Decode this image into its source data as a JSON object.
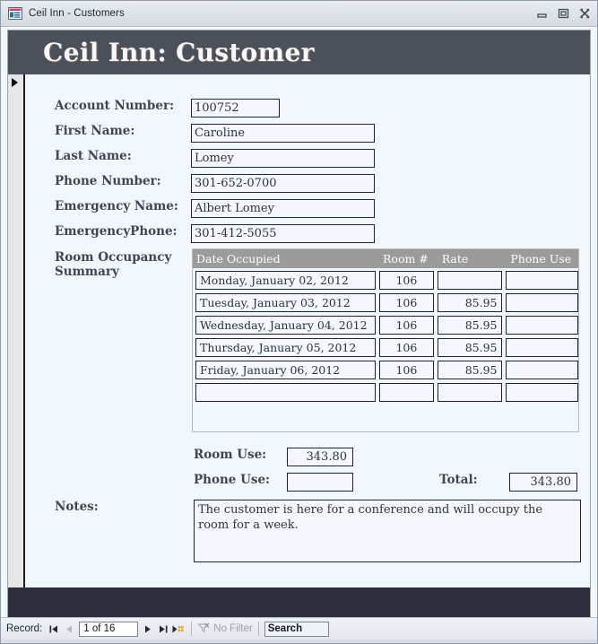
{
  "window": {
    "title": "Ceil Inn - Customers",
    "icon": "access-form-icon",
    "controls": {
      "minimize": "minimize-icon",
      "restore": "restore-icon",
      "close": "close-icon"
    }
  },
  "form": {
    "header_title": "Ceil Inn: Customer",
    "fields": [
      {
        "label": "Account Number:",
        "value": "100752"
      },
      {
        "label": "First Name:",
        "value": "Caroline"
      },
      {
        "label": "Last Name:",
        "value": "Lomey"
      },
      {
        "label": "Phone Number:",
        "value": "301-652-0700"
      },
      {
        "label": "Emergency Name:",
        "value": "Albert Lomey"
      },
      {
        "label": "EmergencyPhone:",
        "value": "301-412-5055"
      }
    ],
    "subform": {
      "label": "Room Occupancy Summary",
      "columns": [
        "Date Occupied",
        "Room #",
        "Rate",
        "Phone Use"
      ],
      "rows": [
        {
          "date": "Monday, January 02, 2012",
          "room": "106",
          "rate": "",
          "phone": ""
        },
        {
          "date": "Tuesday, January 03, 2012",
          "room": "106",
          "rate": "85.95",
          "phone": ""
        },
        {
          "date": "Wednesday, January 04, 2012",
          "room": "106",
          "rate": "85.95",
          "phone": ""
        },
        {
          "date": "Thursday, January 05, 2012",
          "room": "106",
          "rate": "85.95",
          "phone": ""
        },
        {
          "date": "Friday, January 06, 2012",
          "room": "106",
          "rate": "85.95",
          "phone": ""
        },
        {
          "date": "",
          "room": "",
          "rate": "",
          "phone": ""
        }
      ]
    },
    "totals": {
      "room_use_label": "Room Use:",
      "room_use_value": "343.80",
      "phone_use_label": "Phone Use:",
      "phone_use_value": "",
      "total_label": "Total:",
      "total_value": "343.80"
    },
    "notes": {
      "label": "Notes:",
      "value": "The customer is here for a conference and will occupy the room for a week."
    }
  },
  "navbar": {
    "record_label": "Record:",
    "first_icon": "first-record-icon",
    "previous_icon": "previous-record-icon",
    "position": "1 of 16",
    "next_icon": "next-record-icon",
    "last_icon": "last-record-icon",
    "new_icon": "new-record-icon",
    "filter_icon": "filter-icon",
    "filter_label": "No Filter",
    "search_value": "Search"
  },
  "colors": {
    "header_band": "#4b515a",
    "footer_band": "#2c2e3b",
    "form_background": "#f2f7fb",
    "subform_header": "#9b9b9b",
    "label_text": "#3c4654",
    "new_record_accent": "#e8a33d"
  }
}
